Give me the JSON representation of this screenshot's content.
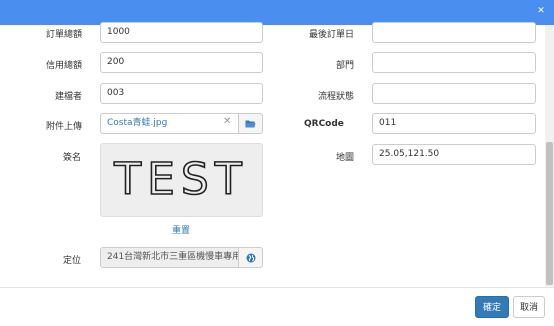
{
  "form": {
    "order_total": {
      "label": "訂單總額",
      "value": "1000"
    },
    "last_order_date": {
      "label": "最後訂單日",
      "value": ""
    },
    "credit_total": {
      "label": "信用總額",
      "value": "200"
    },
    "department": {
      "label": "部門",
      "value": ""
    },
    "creator": {
      "label": "建檔者",
      "value": "003"
    },
    "workflow_status": {
      "label": "流程狀態",
      "value": ""
    },
    "attachment": {
      "label": "附件上傳",
      "file_name": "Costa青蛙.jpg"
    },
    "qrcode": {
      "label": "QRCode",
      "value": "011"
    },
    "signature": {
      "label": "簽名",
      "content": "TEST",
      "reset_label": "重置"
    },
    "map": {
      "label": "地圖",
      "value": "25.05,121.50"
    },
    "location": {
      "label": "定位",
      "value": "241台灣新北市三重區機慢車專用"
    }
  },
  "footer": {
    "confirm_label": "確定",
    "cancel_label": "取消"
  },
  "icons": {
    "close": "close-icon",
    "folder": "folder-open-icon",
    "clear": "clear-icon",
    "globe": "globe-icon"
  },
  "colors": {
    "header": "#4a8ff0",
    "primary": "#337ab7",
    "link": "#337ab7"
  }
}
